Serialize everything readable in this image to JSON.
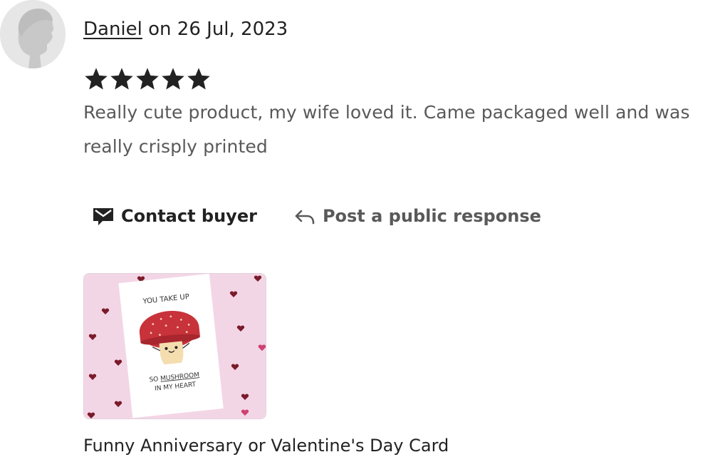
{
  "review": {
    "reviewer_name": "Daniel",
    "date_prefix": "on",
    "date": "26 Jul, 2023",
    "rating": 5,
    "rating_max": 5,
    "text": "Really cute product, my wife loved it. Came packaged well and was really crisply printed"
  },
  "actions": {
    "contact_label": "Contact buyer",
    "respond_label": "Post a public response"
  },
  "product": {
    "title": "Funny Anniversary or Valentine's Day Card",
    "card_text_top": "YOU TAKE UP",
    "card_text_bottom_line1_pre": "SO",
    "card_text_bottom_line1_em": "MUSHROOM",
    "card_text_bottom_line2": "IN MY HEART"
  },
  "colors": {
    "text_primary": "#222222",
    "text_secondary": "#595959",
    "star": "#222222",
    "thumb_background": "#f3d6e6",
    "mushroom_cap": "#c8323a"
  },
  "icons": {
    "contact": "envelope-icon",
    "respond": "reply-arrow-icon",
    "star": "star-icon",
    "avatar": "default-avatar-icon"
  }
}
